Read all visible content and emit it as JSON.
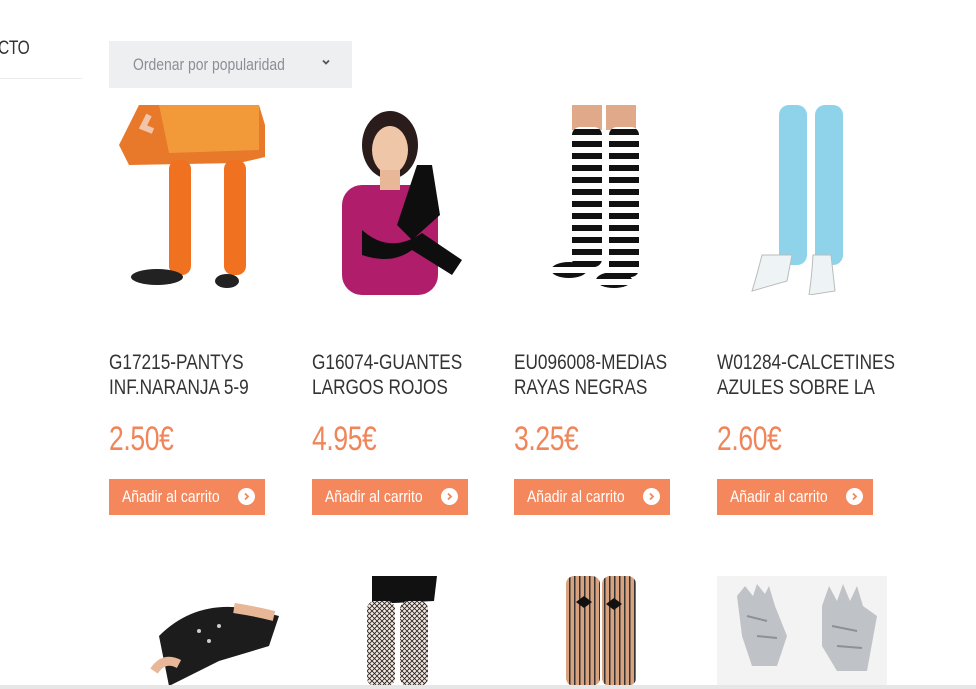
{
  "sidebar": {
    "title_fragment": "CTO"
  },
  "sort": {
    "selected": "Ordenar por popularidad",
    "icon": "chevron-down-icon"
  },
  "products": [
    {
      "title_line1": "G17215-PANTYS",
      "title_line2": "INF.NARANJA 5-9",
      "price": "2.50€",
      "cart_label": "Añadir al carrito",
      "image": "orange-tights-photo"
    },
    {
      "title_line1": "G16074-GUANTES",
      "title_line2": "LARGOS ROJOS",
      "price": "4.95€",
      "cart_label": "Añadir al carrito",
      "image": "long-black-gloves-photo"
    },
    {
      "title_line1": "EU096008-MEDIAS",
      "title_line2": "RAYAS NEGRAS",
      "price": "3.25€",
      "cart_label": "Añadir al carrito",
      "image": "striped-stockings-photo"
    },
    {
      "title_line1": "W01284-CALCETINES",
      "title_line2": "AZULES SOBRE LA",
      "price": "2.60€",
      "cart_label": "Añadir al carrito",
      "image": "blue-stockings-photo"
    }
  ],
  "row2_images": [
    "fingerless-studded-gloves-photo",
    "fishnet-tights-photo",
    "bow-striped-stockings-photo",
    "silver-sequin-gloves-photo"
  ],
  "colors": {
    "accent": "#f4875c",
    "price": "#f0855a",
    "select_bg": "#eeeff1"
  }
}
